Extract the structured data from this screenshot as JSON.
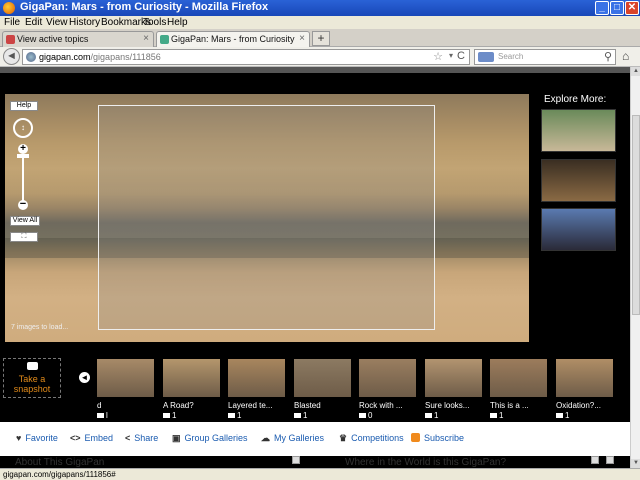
{
  "window": {
    "title": "GigaPan: Mars - from Curiosity - Mozilla Firefox",
    "minimize": "_",
    "maximize": "□",
    "close": "✕"
  },
  "menu": [
    "File",
    "Edit",
    "View",
    "History",
    "Bookmarks",
    "Tools",
    "Help"
  ],
  "tabs": [
    {
      "label": "View active topics",
      "active": false
    },
    {
      "label": "GigaPan: Mars - from Curiosity",
      "active": true
    }
  ],
  "tab_close": "×",
  "new_tab": "+",
  "nav": {
    "back": "◄",
    "url_host": "gigapan.com",
    "url_path": "/gigapans/111856",
    "star": "☆",
    "dropdown": "▾",
    "reload": "C",
    "search_placeholder": "Search",
    "search_mag": "⚲",
    "home": "⌂"
  },
  "viewer": {
    "help": "Help",
    "nav_arrows": "↕",
    "zoom_in": "+",
    "zoom_out": "−",
    "view_all": "View All",
    "fullscreen": "⛶",
    "loading": "7 images to load..."
  },
  "explore": {
    "title": "Explore More:",
    "thumbs": [
      {
        "name": "explore-thumb-1",
        "color_top": "#6a8a5a",
        "color_bottom": "#c8b898"
      },
      {
        "name": "explore-thumb-2",
        "color_top": "#3a2e22",
        "color_bottom": "#8a6a44"
      },
      {
        "name": "explore-thumb-3",
        "color_top": "#5a7ab0",
        "color_bottom": "#2a2a38"
      }
    ]
  },
  "snapshot": {
    "line1": "Take a",
    "line2": "snapshot"
  },
  "strip": {
    "prev": "◄",
    "next": "►",
    "items": [
      {
        "title": "d",
        "count": "l",
        "color": "#a78a68"
      },
      {
        "title": "A Road?",
        "count": "1",
        "color": "#b4966c"
      },
      {
        "title": "Layered te...",
        "count": "1",
        "color": "#a8865e"
      },
      {
        "title": "Blasted",
        "count": "1",
        "color": "#8c7a62"
      },
      {
        "title": "Rock with ...",
        "count": "0",
        "color": "#9a7e60"
      },
      {
        "title": "Sure looks...",
        "count": "1",
        "color": "#b29470"
      },
      {
        "title": "This is a ...",
        "count": "1",
        "color": "#9c7c5c"
      },
      {
        "title": "Oxidation?...",
        "count": "1",
        "color": "#b08e66"
      }
    ]
  },
  "actions": [
    {
      "label": "Favorite",
      "icon": "♥",
      "name": "favorite"
    },
    {
      "label": "Embed",
      "icon": "<>",
      "name": "embed"
    },
    {
      "label": "Share",
      "icon": "<",
      "name": "share"
    },
    {
      "label": "Group Galleries",
      "icon": "▣",
      "name": "group-galleries"
    },
    {
      "label": "My Galleries",
      "icon": "☁",
      "name": "my-galleries"
    },
    {
      "label": "Competitions",
      "icon": "♛",
      "name": "competitions"
    },
    {
      "label": "Subscribe",
      "icon": "",
      "name": "subscribe"
    }
  ],
  "sections": {
    "about": "About This GigaPan",
    "where": "Where in the World is this GigaPan?"
  },
  "status": "gigapan.com/gigapans/111856#",
  "colors": {
    "accent": "#e08a1a",
    "link": "#1a5bb0"
  }
}
